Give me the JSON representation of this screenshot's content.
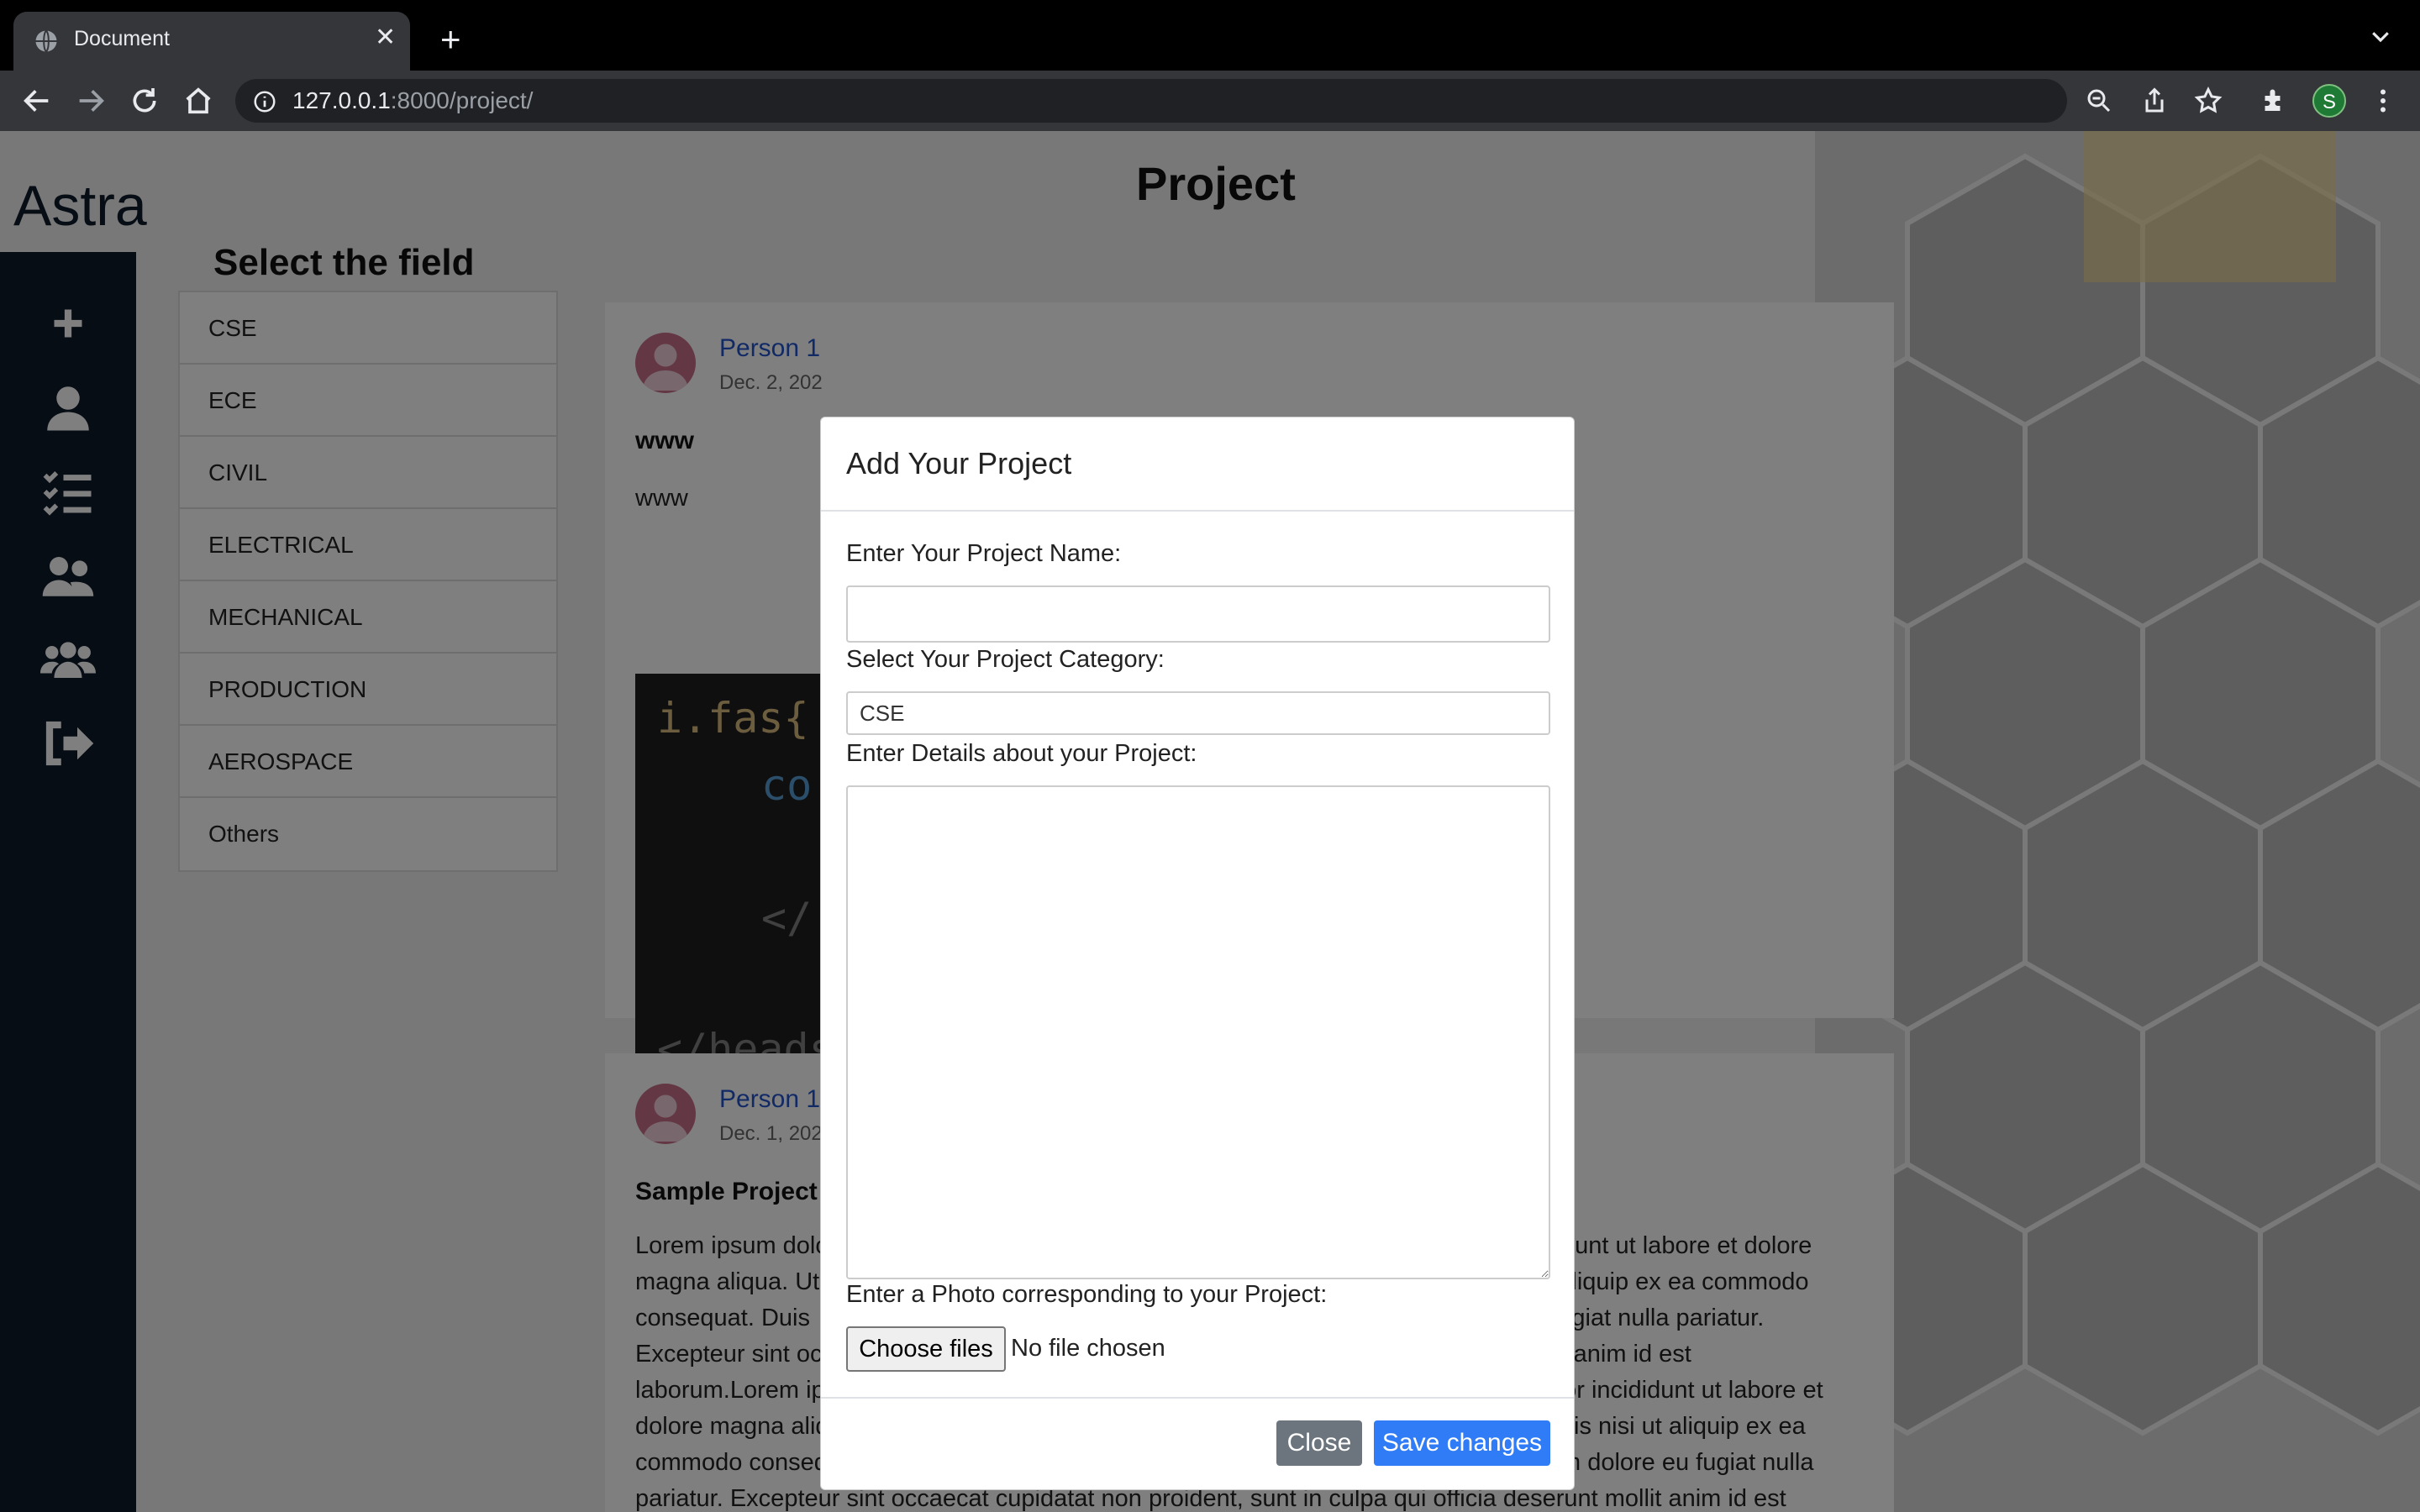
{
  "browser": {
    "tab_title": "Document",
    "url_host": "127.0.0.1",
    "url_path": ":8000/project/",
    "profile_initial": "S"
  },
  "page": {
    "title": "Project",
    "logo_text": "Astra",
    "field_heading": "Select the field",
    "fields": [
      "CSE",
      "ECE",
      "CIVIL",
      "ELECTRICAL",
      "MECHANICAL",
      "PRODUCTION",
      "AEROSPACE",
      "Others"
    ],
    "sidebar_icons": [
      "plus-icon",
      "user-icon",
      "list-check-icon",
      "users-icon",
      "users-group-icon",
      "sign-out-icon"
    ],
    "posts": [
      {
        "author": "Person 1",
        "date": "Dec. 2, 202",
        "title": "www",
        "text": "www",
        "code_lines": [
          "i.fas{",
          "co",
          "</",
          "</heads"
        ]
      },
      {
        "author": "Person 1",
        "date": "Dec. 1, 202",
        "title": "Sample Project",
        "text_lines": [
          "Lorem ipsum dolo",
          "magna aliqua. Ut",
          "consequat. Duis",
          "Excepteur sint occaecat cupidatat non proident, sunt in culpa qui officia deserunt mollit anim id est",
          "laborum.Lorem ipsum dolor sit amet, consectetur adipiscing elit, sed do eiusmod tempor incididunt ut labore et",
          "dolore magna aliqua. Ut enim ad minim veniam, quis nostrud exercitation ullamco laboris nisi ut aliquip ex ea",
          "commodo consequat. Duis aute irure dolor in reprehenderit in voluptate velit esse cillum dolore eu fugiat nulla",
          "pariatur. Excepteur sint occaecat cupidatat non proident, sunt in culpa qui officia deserunt mollit anim id est"
        ],
        "text_right_lines": [
          "dunt ut labore et dolore",
          "ut aliquip ex ea commodo",
          "u fugiat nulla pariatur."
        ]
      }
    ]
  },
  "modal": {
    "title": "Add Your Project",
    "name_label": "Enter Your Project Name:",
    "name_value": "",
    "category_label": "Select Your Project Category:",
    "category_value": "CSE",
    "details_label": "Enter Details about your Project:",
    "details_value": "",
    "photo_label": "Enter a Photo corresponding to your Project:",
    "file_button": "Choose files",
    "file_status": "No file chosen",
    "close_button": "Close",
    "save_button": "Save changes"
  },
  "colors": {
    "primary": "#2f7cf6",
    "secondary": "#6c757d",
    "sidebar": "#0e1a2b",
    "author_link": "#2255cc"
  }
}
